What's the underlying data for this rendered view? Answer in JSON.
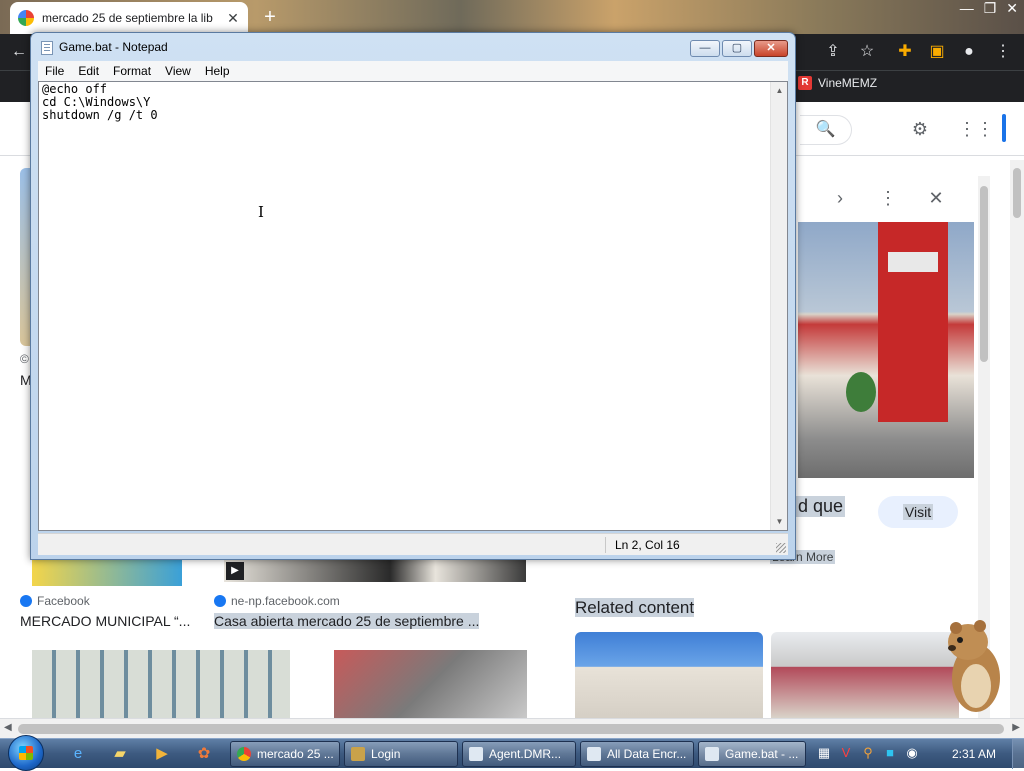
{
  "browser": {
    "tab_title": "mercado 25 de septiembre la lib",
    "tab_close": "✕",
    "new_tab": "+",
    "bookmark": "VineMEMZ",
    "bookmark_badge": "R",
    "icons": [
      "back-icon",
      "share-icon",
      "star-icon",
      "extensions-icon",
      "sidepanel-icon",
      "profile-icon",
      "menu-icon"
    ]
  },
  "page": {
    "left_fragments": [
      "©",
      "M"
    ],
    "cards": [
      {
        "source": "Facebook",
        "title": "MERCADO MUNICIPAL “..."
      },
      {
        "source": "ne-np.facebook.com",
        "title": "Casa abierta mercado 25 de septiembre ..."
      }
    ],
    "side_panel": {
      "title_fragment": "d que",
      "visit": "Visit",
      "learn_more": "Learn More"
    },
    "related": "Related content"
  },
  "notepad": {
    "title": "Game.bat - Notepad",
    "menus": [
      "File",
      "Edit",
      "Format",
      "View",
      "Help"
    ],
    "content": "@echo off\ncd C:\\Windows\\Y\nshutdown /g /t 0",
    "status": "Ln 2, Col 16",
    "controls": {
      "minimize": "—",
      "maximize": "▢",
      "close": "✕"
    }
  },
  "taskbar": {
    "tasks": [
      {
        "label": "mercado 25 ...",
        "icon_color": "#e94235"
      },
      {
        "label": "Login",
        "icon_color": "#c9a24a"
      },
      {
        "label": "Agent.DMR...",
        "icon_color": "#dfe8f2"
      },
      {
        "label": "All Data Encr...",
        "icon_color": "#dfe8f2"
      },
      {
        "label": "Game.bat - ...",
        "icon_color": "#dfe8f2"
      }
    ],
    "clock": "2:31 AM"
  }
}
